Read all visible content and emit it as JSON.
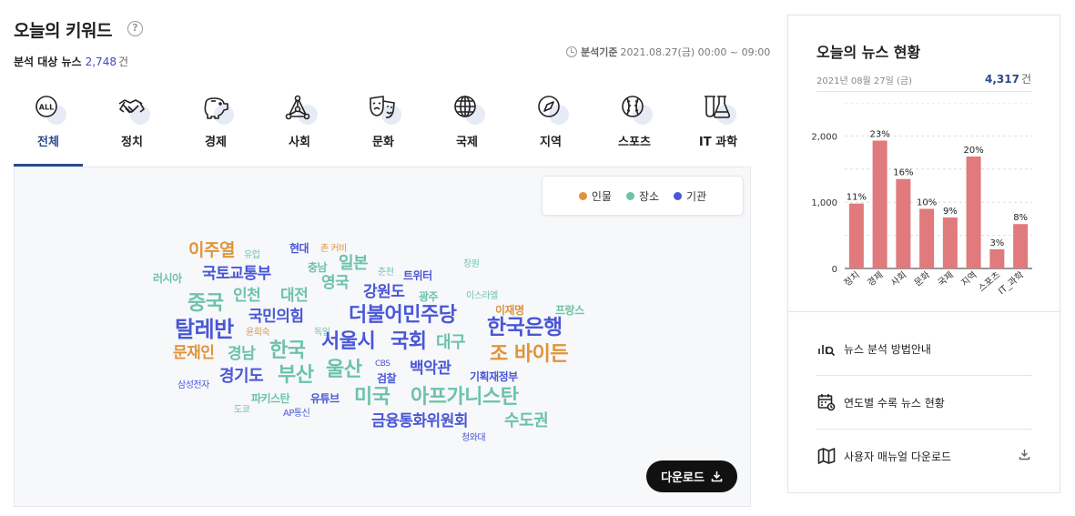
{
  "header": {
    "title": "오늘의 키워드",
    "count_label": "분석 대상 뉴스",
    "count_value": "2,748",
    "count_unit": "건",
    "basis_label": "분석기준",
    "basis_value": "2021.08.27(금) 00:00 ~ 09:00"
  },
  "tabs": [
    {
      "label": "전체",
      "icon": "all-icon",
      "active": true
    },
    {
      "label": "정치",
      "icon": "handshake-icon"
    },
    {
      "label": "경제",
      "icon": "piggy-bank-icon"
    },
    {
      "label": "사회",
      "icon": "network-icon"
    },
    {
      "label": "문화",
      "icon": "theater-masks-icon"
    },
    {
      "label": "국제",
      "icon": "globe-icon"
    },
    {
      "label": "지역",
      "icon": "compass-icon"
    },
    {
      "label": "스포츠",
      "icon": "baseball-icon"
    },
    {
      "label": "IT 과학",
      "icon": "flask-icon"
    }
  ],
  "legend": [
    {
      "label": "인물",
      "color": "#e0943a"
    },
    {
      "label": "장소",
      "color": "#6cc3a7"
    },
    {
      "label": "기관",
      "color": "#4a57d6"
    }
  ],
  "colors": {
    "person": "#e0943a",
    "place": "#6cc3a7",
    "org": "#4a57d6",
    "accent": "#2d4a8a",
    "bar": "#e07a7c"
  },
  "word_cloud": [
    {
      "text": "이주열",
      "type": "person",
      "size": 19
    },
    {
      "text": "유럽",
      "type": "place",
      "size": 10
    },
    {
      "text": "현대",
      "type": "org",
      "size": 12
    },
    {
      "text": "존 커비",
      "type": "person",
      "size": 10
    },
    {
      "text": "러시아",
      "type": "place",
      "size": 12
    },
    {
      "text": "국토교통부",
      "type": "org",
      "size": 17
    },
    {
      "text": "충남",
      "type": "place",
      "size": 12
    },
    {
      "text": "일본",
      "type": "place",
      "size": 18
    },
    {
      "text": "춘천",
      "type": "place",
      "size": 10
    },
    {
      "text": "트위터",
      "type": "org",
      "size": 12
    },
    {
      "text": "창원",
      "type": "place",
      "size": 10
    },
    {
      "text": "중국",
      "type": "place",
      "size": 22
    },
    {
      "text": "인천",
      "type": "place",
      "size": 17
    },
    {
      "text": "대전",
      "type": "place",
      "size": 17
    },
    {
      "text": "영국",
      "type": "place",
      "size": 17
    },
    {
      "text": "강원도",
      "type": "org",
      "size": 17
    },
    {
      "text": "광주",
      "type": "place",
      "size": 12
    },
    {
      "text": "이스라엘",
      "type": "place",
      "size": 10
    },
    {
      "text": "국민의힘",
      "type": "org",
      "size": 17
    },
    {
      "text": "더불어민주당",
      "type": "org",
      "size": 22
    },
    {
      "text": "이재명",
      "type": "person",
      "size": 12
    },
    {
      "text": "프랑스",
      "type": "place",
      "size": 12
    },
    {
      "text": "탈레반",
      "type": "org",
      "size": 24
    },
    {
      "text": "윤희숙",
      "type": "person",
      "size": 10
    },
    {
      "text": "독일",
      "type": "place",
      "size": 10
    },
    {
      "text": "한국은행",
      "type": "org",
      "size": 23
    },
    {
      "text": "서울시",
      "type": "org",
      "size": 22
    },
    {
      "text": "국회",
      "type": "org",
      "size": 22
    },
    {
      "text": "대구",
      "type": "place",
      "size": 18
    },
    {
      "text": "문재인",
      "type": "person",
      "size": 17
    },
    {
      "text": "경남",
      "type": "place",
      "size": 17
    },
    {
      "text": "한국",
      "type": "place",
      "size": 22
    },
    {
      "text": "조 바이든",
      "type": "person",
      "size": 22
    },
    {
      "text": "CBS",
      "type": "org",
      "size": 9
    },
    {
      "text": "경기도",
      "type": "org",
      "size": 18
    },
    {
      "text": "부산",
      "type": "place",
      "size": 22
    },
    {
      "text": "울산",
      "type": "place",
      "size": 22
    },
    {
      "text": "검찰",
      "type": "org",
      "size": 12
    },
    {
      "text": "백악관",
      "type": "org",
      "size": 17
    },
    {
      "text": "기획재정부",
      "type": "org",
      "size": 12
    },
    {
      "text": "삼성전자",
      "type": "org",
      "size": 10
    },
    {
      "text": "파키스탄",
      "type": "place",
      "size": 12
    },
    {
      "text": "유튜브",
      "type": "org",
      "size": 12
    },
    {
      "text": "미국",
      "type": "place",
      "size": 22
    },
    {
      "text": "아프가니스탄",
      "type": "place",
      "size": 22
    },
    {
      "text": "도쿄",
      "type": "place",
      "size": 10
    },
    {
      "text": "AP통신",
      "type": "org",
      "size": 10
    },
    {
      "text": "금융통화위원회",
      "type": "org",
      "size": 17
    },
    {
      "text": "수도권",
      "type": "place",
      "size": 18
    },
    {
      "text": "청와대",
      "type": "org",
      "size": 10
    }
  ],
  "download_label": "다운로드",
  "side": {
    "title": "오늘의 뉴스 현황",
    "date": "2021년 08월 27일 (금)",
    "total": "4,317",
    "total_unit": "건",
    "menu": [
      {
        "label": "뉴스 분석 방법안내",
        "icon": "analysis-icon"
      },
      {
        "label": "연도별 수록 뉴스 현황",
        "icon": "calendar-icon"
      },
      {
        "label": "사용자 매뉴얼 다운로드",
        "icon": "map-icon"
      }
    ]
  },
  "chart_data": {
    "type": "bar",
    "categories": [
      "정치",
      "경제",
      "사회",
      "문화",
      "국제",
      "지역",
      "스포츠",
      "IT_과학"
    ],
    "values": [
      980,
      1930,
      1350,
      900,
      770,
      1690,
      290,
      670
    ],
    "data_labels": [
      "11%",
      "23%",
      "16%",
      "10%",
      "9%",
      "20%",
      "3%",
      "8%"
    ],
    "yticks": [
      "0",
      "1,000",
      "2,000"
    ],
    "ylim": [
      0,
      2500
    ],
    "grid": true
  }
}
